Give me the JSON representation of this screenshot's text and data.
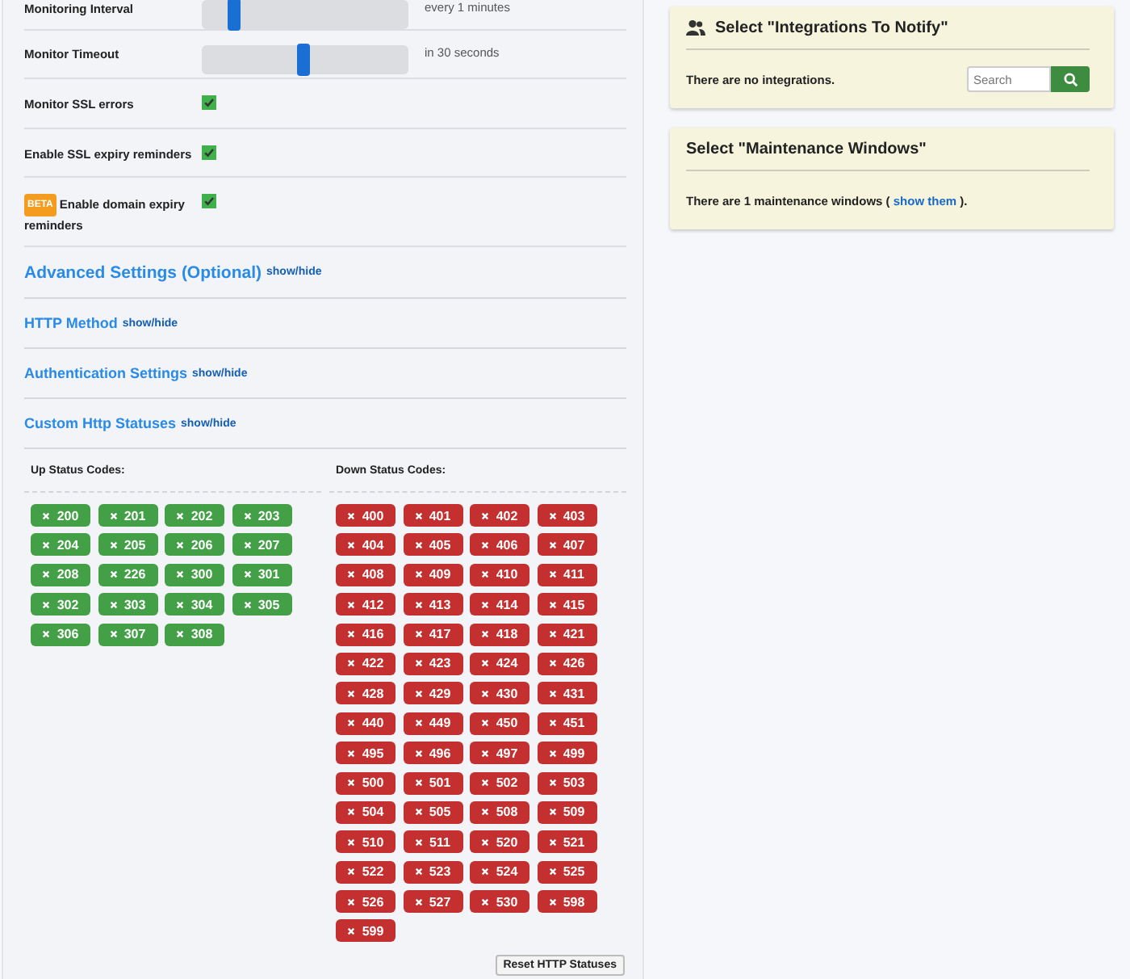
{
  "settings": [
    {
      "kind": "slider",
      "label": "Monitoring Interval",
      "level": 0.16,
      "reading": "every 1 minutes"
    },
    {
      "kind": "slider",
      "label": "Monitor Timeout",
      "level": 0.49,
      "reading": "in 30 seconds"
    },
    {
      "kind": "checkbox",
      "label": "Monitor SSL errors",
      "checked": true
    },
    {
      "kind": "checkbox",
      "label": "Enable SSL expiry reminders",
      "checked": true
    },
    {
      "kind": "checkbox",
      "label": "Enable domain expiry reminders",
      "badge": "BETA",
      "checked": true
    }
  ],
  "sections": [
    {
      "kind": "main",
      "title": "Advanced Settings (Optional)",
      "toggle": "show/hide"
    },
    {
      "kind": "sub",
      "title": "HTTP Method",
      "toggle": "show/hide"
    },
    {
      "kind": "sub",
      "title": "Authentication Settings",
      "toggle": "show/hide"
    },
    {
      "kind": "sub",
      "title": "Custom Http Statuses",
      "toggle": "show/hide"
    }
  ],
  "custom_statuses": {
    "groups": [
      {
        "kind": "up",
        "title": "Up Status Codes:",
        "codes": [
          "200",
          "201",
          "202",
          "203",
          "204",
          "205",
          "206",
          "207",
          "208",
          "226",
          "300",
          "301",
          "302",
          "303",
          "304",
          "305",
          "306",
          "307",
          "308"
        ]
      },
      {
        "kind": "down",
        "title": "Down Status Codes:",
        "codes": [
          "400",
          "401",
          "402",
          "403",
          "404",
          "405",
          "406",
          "407",
          "408",
          "409",
          "410",
          "411",
          "412",
          "413",
          "414",
          "415",
          "416",
          "417",
          "418",
          "421",
          "422",
          "423",
          "424",
          "426",
          "428",
          "429",
          "430",
          "431",
          "440",
          "449",
          "450",
          "451",
          "495",
          "496",
          "497",
          "499",
          "500",
          "501",
          "502",
          "503",
          "504",
          "505",
          "508",
          "509",
          "510",
          "511",
          "520",
          "521",
          "522",
          "523",
          "524",
          "525",
          "526",
          "527",
          "530",
          "598",
          "599"
        ]
      }
    ],
    "reset_button": "Reset HTTP Statuses"
  },
  "integrations": {
    "title": "Select \"Integrations To Notify\"",
    "message": "There are no integrations.",
    "search": {
      "placeholder": "Search"
    }
  },
  "maintenance": {
    "title": "Select \"Maintenance Windows\"",
    "message_before": "There are 1 maintenance windows ( ",
    "link": "show them",
    "message_after": " )."
  }
}
